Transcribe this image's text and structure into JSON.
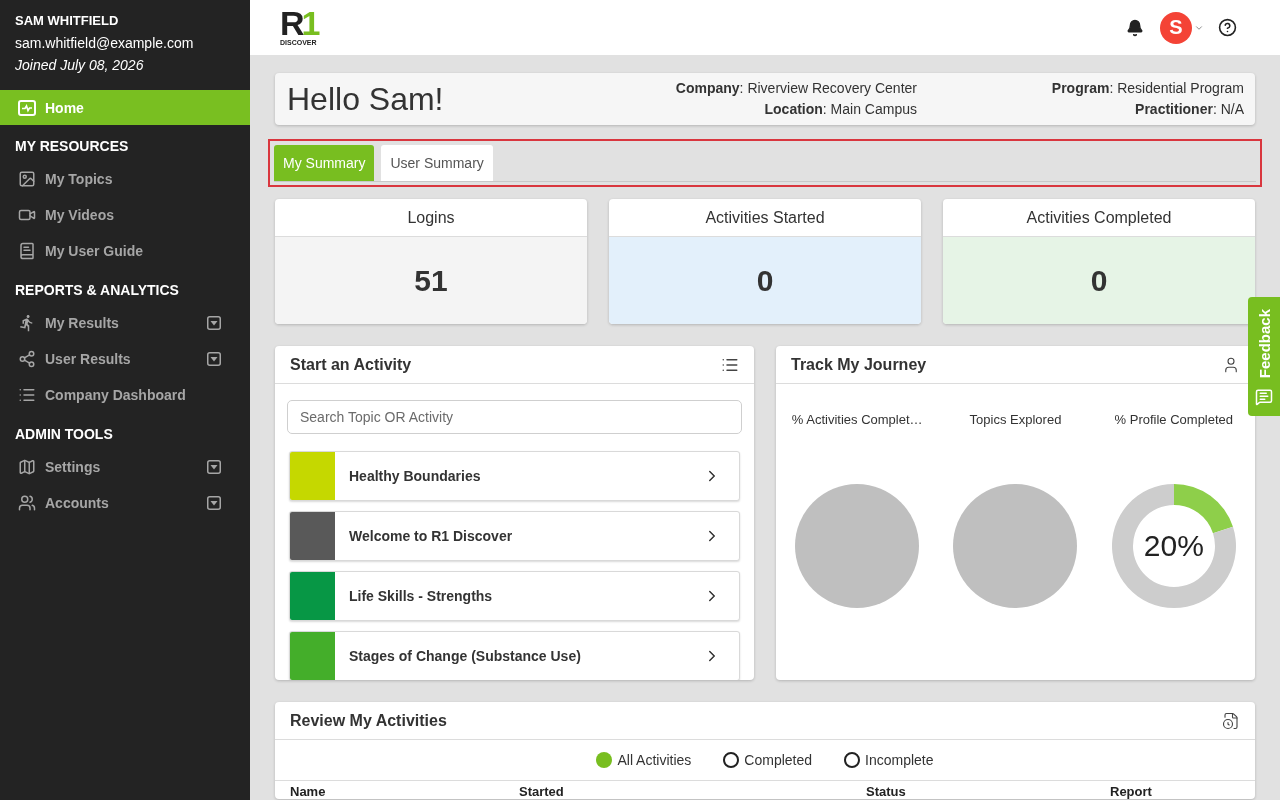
{
  "sidebar": {
    "user": {
      "name": "SAM WHITFIELD",
      "email": "sam.whitfield@example.com",
      "joined": "Joined July 08, 2026"
    },
    "home": {
      "label": "Home",
      "selected": true
    },
    "sections": [
      {
        "title": "MY RESOURCES",
        "items": [
          {
            "label": "My Topics",
            "selected": false,
            "expandable": false
          },
          {
            "label": "My Videos",
            "selected": false,
            "expandable": false
          },
          {
            "label": "My User Guide",
            "selected": false,
            "expandable": false
          }
        ]
      },
      {
        "title": "REPORTS & ANALYTICS",
        "items": [
          {
            "label": "My Results",
            "selected": false,
            "expandable": true
          },
          {
            "label": "User Results",
            "selected": false,
            "expandable": true
          },
          {
            "label": "Company Dashboard",
            "selected": false,
            "expandable": false
          }
        ]
      },
      {
        "title": "ADMIN TOOLS",
        "items": [
          {
            "label": "Settings",
            "selected": false,
            "expandable": true
          },
          {
            "label": "Accounts",
            "selected": false,
            "expandable": true
          }
        ]
      }
    ]
  },
  "header": {
    "logo": {
      "parts": [
        {
          "text": "R",
          "color": "#222222"
        },
        {
          "text": "1",
          "color": "#78be20"
        }
      ],
      "caption": "DISCOVER"
    },
    "avatar": {
      "initial": "S"
    }
  },
  "greeting": {
    "title": "Hello Sam!",
    "columns": [
      [
        "**Company**: Riverview Recovery Center",
        "**Location**: Main Campus"
      ],
      [
        "**Program**: Residential Program",
        "**Practitioner**: N/A"
      ]
    ]
  },
  "summary_tabs": {
    "highlighted": true,
    "tabs": [
      {
        "label": "My Summary",
        "selected": true
      },
      {
        "label": "User Summary",
        "selected": false
      }
    ]
  },
  "stats": [
    {
      "label": "Logins",
      "value": "51",
      "color": "#f4f4f4"
    },
    {
      "label": "Activities Started",
      "value": "0",
      "color": "#e3f0fb"
    },
    {
      "label": "Activities Completed",
      "value": "0",
      "color": "#e6f4e6"
    }
  ],
  "activities": {
    "title": "Start an Activity",
    "search": {
      "placeholder": "Search Topic OR Activity"
    },
    "items": [
      {
        "label": "Healthy Boundaries",
        "color": "#c5d800"
      },
      {
        "label": "Welcome to R1 Discover",
        "color": "#595959"
      },
      {
        "label": "Life Skills - Strengths",
        "color": "#079745"
      },
      {
        "label": "Stages of Change (Substance Use)",
        "color": "#44ae2a"
      }
    ]
  },
  "journey": {
    "title": "Track My Journey",
    "gauges": [
      {
        "label": "% Activities Complet…",
        "kind": "disc"
      },
      {
        "label": "Topics Explored",
        "kind": "disc"
      },
      {
        "label": "% Profile Completed",
        "kind": "ring",
        "reading": "20%",
        "chart_data": {
          "type": "donut",
          "values": [
            20,
            80
          ]
        }
      }
    ]
  },
  "review": {
    "title": "Review My Activities",
    "filters": [
      {
        "label": "All Activities",
        "selected": true
      },
      {
        "label": "Completed",
        "selected": false
      },
      {
        "label": "Incomplete",
        "selected": false
      }
    ],
    "columns": [
      "Name",
      "Started",
      "Status",
      "Report"
    ]
  },
  "feedback": {
    "label": "Feedback"
  }
}
